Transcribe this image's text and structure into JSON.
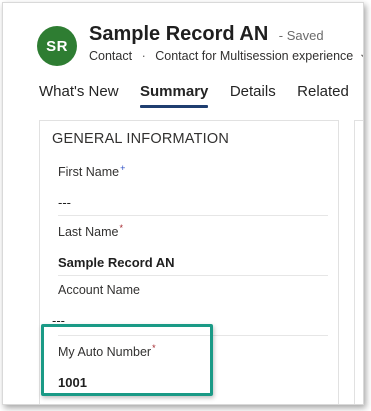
{
  "record": {
    "avatar_initials": "SR",
    "title": "Sample Record AN",
    "status": "- Saved",
    "entity": "Contact",
    "separator": "·",
    "form_name": "Contact for Multisession experience",
    "form_selector_icon": "chevron-down-icon"
  },
  "tabs": [
    {
      "label": "What's New",
      "active": false
    },
    {
      "label": "Summary",
      "active": true
    },
    {
      "label": "Details",
      "active": false
    },
    {
      "label": "Related",
      "active": false
    }
  ],
  "section": {
    "title": "GENERAL INFORMATION",
    "fields": [
      {
        "label": "First Name",
        "required_marker": "+",
        "value": "---"
      },
      {
        "label": "Last Name",
        "required_marker": "*",
        "value": "Sample Record AN"
      },
      {
        "label": "Account Name",
        "required_marker": "",
        "value": "---"
      },
      {
        "label": "My Auto Number",
        "required_marker": "*",
        "value": "1001"
      }
    ]
  },
  "colors": {
    "avatar": "#2e7d32",
    "active_tab_underline": "#1f3e70",
    "required": "#a4262c",
    "highlight_border": "#1a9a86"
  }
}
